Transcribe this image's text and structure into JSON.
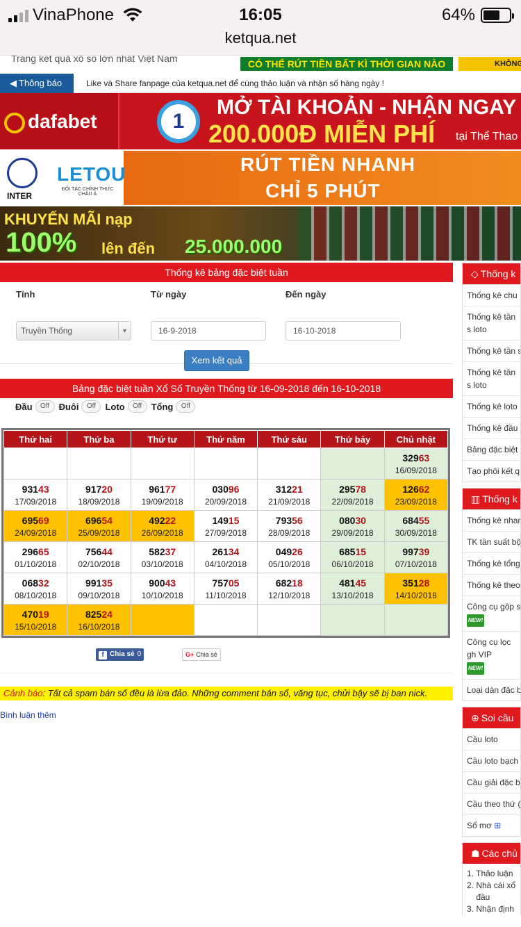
{
  "status_bar": {
    "carrier": "VinaPhone",
    "time": "16:05",
    "battery": "64%",
    "battery_level": 0.64,
    "url": "ketqua.net"
  },
  "header": {
    "tagline": "Trang kết quả xổ số lớn nhất Việt Nam",
    "promo_green": "CÓ THỂ RÚT TIỀN BẤT KÌ THỜI GIAN NÀO",
    "promo_yellow": "KHÔNG"
  },
  "notice": {
    "label": "Thông báo",
    "text": "Like và Share fanpage của ketqua.net để cùng thảo luận và nhận số hàng ngày !"
  },
  "banners": {
    "dafabet": {
      "logo": "dafabet",
      "number": "1",
      "line1": "MỞ TÀI KHOẢN - NHẬN NGAY",
      "line2": "200.000Đ MIỄN PHÍ",
      "line3": "tại Thể Thao ở"
    },
    "letou": {
      "inter": "INTER",
      "logo": "LETOU",
      "sub": "ĐỐI TÁC CHÍNH THỨC CHÂU Á",
      "line1": "RÚT TIỀN NHANH",
      "line2": "CHỈ 5 PHÚT"
    },
    "khuyenmai": {
      "line1": "KHUYẾN MÃI nạp",
      "line2": "100%",
      "line3": "lên đến",
      "line4": "25.000.000"
    }
  },
  "filter": {
    "title": "Thống kê bảng đặc biệt tuần",
    "province_label": "Tỉnh",
    "province_value": "Truyền Thống",
    "from_label": "Từ ngày",
    "from_value": "16-9-2018",
    "to_label": "Đến ngày",
    "to_value": "16-10-2018",
    "submit": "Xem kết quả"
  },
  "result": {
    "title": "Bảng đặc biệt tuần Xổ Số Truyền Thống từ 16-09-2018 đến 16-10-2018",
    "toggles": [
      {
        "label": "Đầu",
        "state": "Off"
      },
      {
        "label": "Đuôi",
        "state": "Off"
      },
      {
        "label": "Loto",
        "state": "Off"
      },
      {
        "label": "Tổng",
        "state": "Off"
      }
    ],
    "columns": [
      "Thứ hai",
      "Thứ ba",
      "Thứ tư",
      "Thứ năm",
      "Thứ sáu",
      "Thứ bảy",
      "Chủ nhật"
    ],
    "rows": [
      [
        null,
        null,
        null,
        null,
        null,
        null,
        {
          "head": "329",
          "tail": "63",
          "date": "16/09/2018"
        }
      ],
      [
        {
          "head": "931",
          "tail": "43",
          "date": "17/09/2018"
        },
        {
          "head": "917",
          "tail": "20",
          "date": "18/09/2018"
        },
        {
          "head": "961",
          "tail": "77",
          "date": "19/09/2018"
        },
        {
          "head": "030",
          "tail": "96",
          "date": "20/09/2018"
        },
        {
          "head": "312",
          "tail": "21",
          "date": "21/09/2018"
        },
        {
          "head": "295",
          "tail": "78",
          "date": "22/09/2018"
        },
        {
          "head": "126",
          "tail": "62",
          "date": "23/09/2018",
          "hl": true
        }
      ],
      [
        {
          "head": "695",
          "tail": "69",
          "date": "24/09/2018",
          "hl": true
        },
        {
          "head": "696",
          "tail": "54",
          "date": "25/09/2018",
          "hl": true
        },
        {
          "head": "492",
          "tail": "22",
          "date": "26/09/2018",
          "hl": true
        },
        {
          "head": "149",
          "tail": "15",
          "date": "27/09/2018"
        },
        {
          "head": "793",
          "tail": "56",
          "date": "28/09/2018"
        },
        {
          "head": "080",
          "tail": "30",
          "date": "29/09/2018"
        },
        {
          "head": "684",
          "tail": "55",
          "date": "30/09/2018"
        }
      ],
      [
        {
          "head": "296",
          "tail": "65",
          "date": "01/10/2018"
        },
        {
          "head": "756",
          "tail": "44",
          "date": "02/10/2018"
        },
        {
          "head": "582",
          "tail": "37",
          "date": "03/10/2018"
        },
        {
          "head": "261",
          "tail": "34",
          "date": "04/10/2018"
        },
        {
          "head": "049",
          "tail": "26",
          "date": "05/10/2018"
        },
        {
          "head": "685",
          "tail": "15",
          "date": "06/10/2018"
        },
        {
          "head": "997",
          "tail": "39",
          "date": "07/10/2018"
        }
      ],
      [
        {
          "head": "068",
          "tail": "32",
          "date": "08/10/2018"
        },
        {
          "head": "991",
          "tail": "35",
          "date": "09/10/2018"
        },
        {
          "head": "900",
          "tail": "43",
          "date": "10/10/2018"
        },
        {
          "head": "757",
          "tail": "05",
          "date": "11/10/2018"
        },
        {
          "head": "682",
          "tail": "18",
          "date": "12/10/2018"
        },
        {
          "head": "481",
          "tail": "45",
          "date": "13/10/2018"
        },
        {
          "head": "351",
          "tail": "28",
          "date": "14/10/2018",
          "hl": true
        }
      ],
      [
        {
          "head": "470",
          "tail": "19",
          "date": "15/10/2018",
          "hl": true
        },
        {
          "head": "825",
          "tail": "24",
          "date": "16/10/2018",
          "hl": true
        },
        {
          "hl": true
        },
        null,
        null,
        null,
        null
      ]
    ]
  },
  "share": {
    "facebook": "Chia sẻ",
    "facebook_count": "0",
    "google": "Chia sẻ"
  },
  "warning": {
    "label": "Cảnh báo",
    "text": ": Tất cả spam bán số đều là lừa đảo. Những comment bán số, văng tục, chửi bậy sẽ bị ban nick."
  },
  "comment_link": "Bình luận thêm",
  "sidebar": {
    "box1": {
      "title": "Thống k",
      "items": [
        {
          "text": "Thống kê chu"
        },
        {
          "text": "Thống kê tần s loto"
        },
        {
          "text": "Thống kê tần s"
        },
        {
          "text": "Thống kê tần s loto"
        },
        {
          "text": "Thống kê loto"
        },
        {
          "text": "Thống kê đầu"
        },
        {
          "text": "Bảng đặc biệt"
        },
        {
          "text": "Tạo phôi kết q"
        }
      ]
    },
    "box2": {
      "title": "Thống k",
      "items": [
        {
          "text": "Thống kê nhan"
        },
        {
          "text": "TK tần suất bộ"
        },
        {
          "text": "Thống kê tổng"
        },
        {
          "text": "Thống kê theo"
        },
        {
          "text": "Công cụ gộp s",
          "new": "NEW!"
        },
        {
          "text": "Công cụ lọc gh VIP",
          "new": "NEW!"
        },
        {
          "text": "Loại dàn đặc b"
        }
      ]
    },
    "box3": {
      "title": "Soi cầu",
      "items": [
        {
          "text": "Cầu loto"
        },
        {
          "text": "Cầu loto bạch"
        },
        {
          "text": "Cầu giải đặc b"
        },
        {
          "text": "Cầu theo thứ ("
        },
        {
          "text": "Sổ mơ",
          "plus": "⊞"
        }
      ]
    },
    "box4": {
      "title": "Các chủ",
      "items": [
        "Thảo luận",
        "Nhà cái xổ",
        "đầu",
        "Nhận định"
      ],
      "numbers": [
        "1.",
        "2.",
        "",
        "3."
      ]
    }
  }
}
